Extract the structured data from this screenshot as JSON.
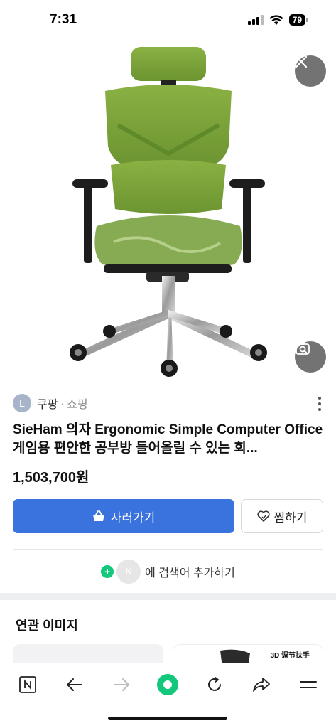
{
  "status_bar": {
    "time": "7:31",
    "battery": "79"
  },
  "viewer": {
    "close_icon": "close-icon",
    "lens_icon": "image-search-icon",
    "chair_color": "#7da33a"
  },
  "source": {
    "avatar_letter": "L",
    "name": "쿠팡",
    "separator": "·",
    "category": "쇼핑"
  },
  "product": {
    "title": "SieHam 의자 Ergonomic Simple Computer Office 게임용 편안한 공부방 들어올릴 수 있는 회...",
    "price": "1,503,700원"
  },
  "actions": {
    "buy_label": "사러가기",
    "wish_label": "찜하기",
    "buy_color": "#3b73de"
  },
  "keyword": {
    "avatar_letter": "N",
    "text": "에 검색어 추가하기"
  },
  "related": {
    "title": "연관 이미지",
    "thumb2_caption": "3D 调节扶手"
  },
  "toolbar": {
    "items": [
      "naver-n-icon",
      "back-arrow-icon",
      "forward-arrow-icon",
      "green-home-icon",
      "refresh-icon",
      "share-icon",
      "menu-icon"
    ]
  }
}
